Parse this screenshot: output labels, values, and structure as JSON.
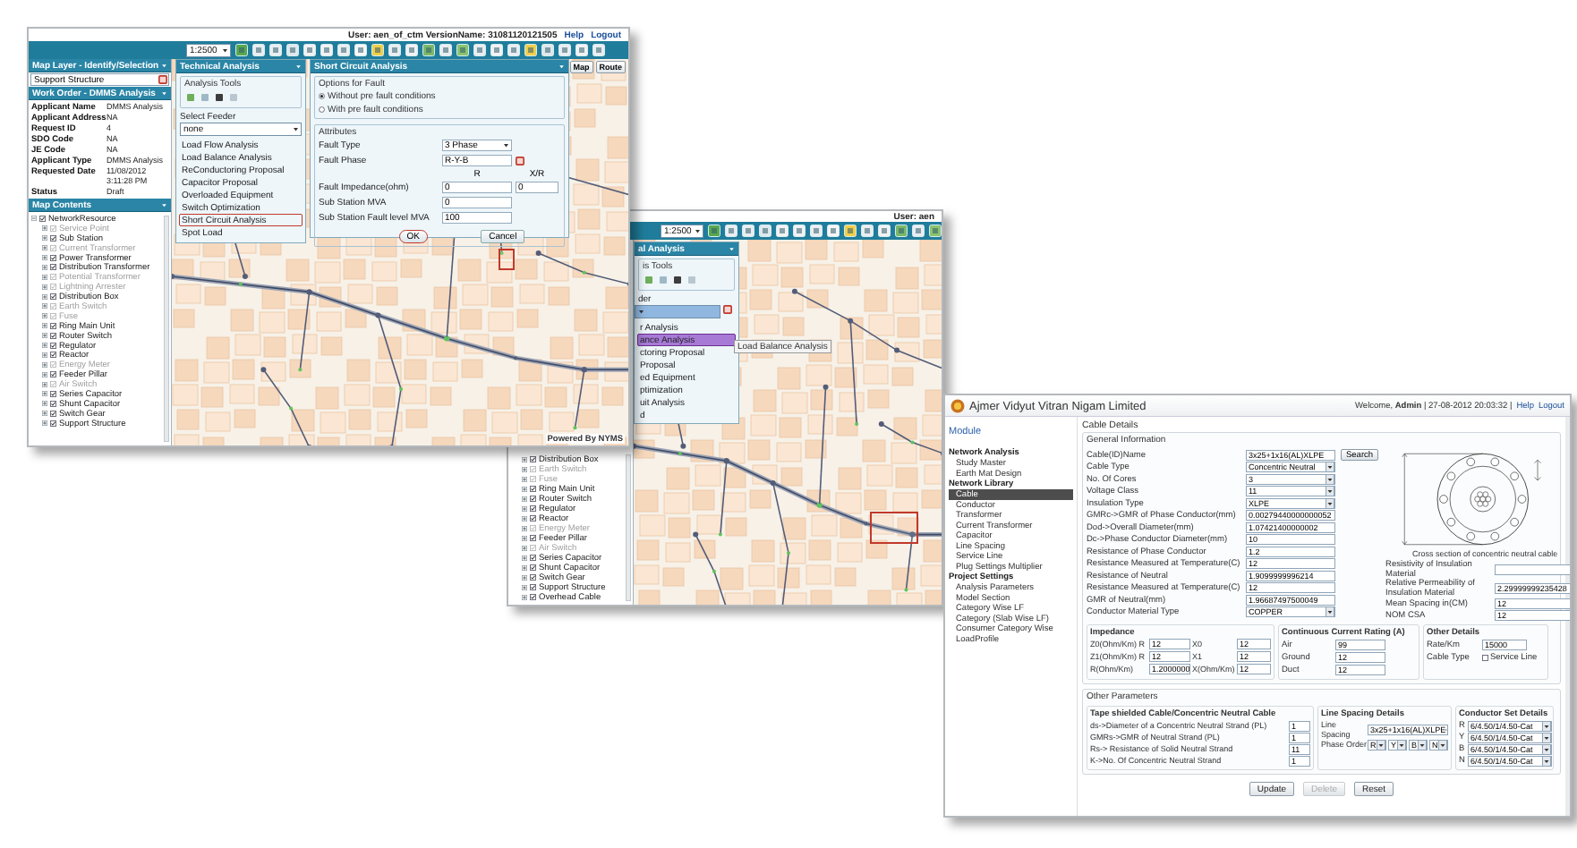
{
  "analysis_window": {
    "user_info": "User: aen",
    "scale": "1:2500",
    "tree_items": [
      {
        "label": "Distribution Box",
        "enabled": true
      },
      {
        "label": "Earth Switch",
        "enabled": false
      },
      {
        "label": "Fuse",
        "enabled": false
      },
      {
        "label": "Ring Main Unit",
        "enabled": true
      },
      {
        "label": "Router Switch",
        "enabled": true
      },
      {
        "label": "Regulator",
        "enabled": true
      },
      {
        "label": "Reactor",
        "enabled": true
      },
      {
        "label": "Energy Meter",
        "enabled": false
      },
      {
        "label": "Feeder Pillar",
        "enabled": true
      },
      {
        "label": "Air Switch",
        "enabled": false
      },
      {
        "label": "Series Capacitor",
        "enabled": true
      },
      {
        "label": "Shunt Capacitor",
        "enabled": true
      },
      {
        "label": "Switch Gear",
        "enabled": true
      },
      {
        "label": "Support Structure",
        "enabled": true
      },
      {
        "label": "Overhead Cable",
        "enabled": true
      }
    ],
    "technical_analysis": {
      "title": "al Analysis",
      "tools_label": "is Tools",
      "feeder_label": "der",
      "items": [
        {
          "label": "r Analysis",
          "selected": false
        },
        {
          "label": "ance Analysis",
          "selected": true
        },
        {
          "label": "ctoring Proposal",
          "selected": false
        },
        {
          "label": "Proposal",
          "selected": false
        },
        {
          "label": "ed Equipment",
          "selected": false
        },
        {
          "label": "ptimization",
          "selected": false
        },
        {
          "label": "uit Analysis",
          "selected": false
        },
        {
          "label": "d",
          "selected": false
        }
      ]
    },
    "tooltip": "Load Balance Analysis"
  },
  "map_window": {
    "user_info": "User: aen_of_ctm VersionName: 31081120121505",
    "links": [
      "Help",
      "Logout"
    ],
    "scale": "1:2500",
    "layer_panel": {
      "title": "Map Layer - Identify/Selection",
      "value": "Support Structure"
    },
    "work_order": {
      "title": "Work Order - DMMS Analysis",
      "rows": [
        {
          "label": "Applicant Name",
          "value": "DMMS Analysis"
        },
        {
          "label": "Applicant Address",
          "value": "NA"
        },
        {
          "label": "Request ID",
          "value": "4"
        },
        {
          "label": "SDO Code",
          "value": "NA"
        },
        {
          "label": "JE Code",
          "value": "NA"
        },
        {
          "label": "Applicant Type",
          "value": "DMMS Analysis"
        },
        {
          "label": "Requested Date",
          "value": "11/08/2012 3:11:28 PM"
        },
        {
          "label": "Status",
          "value": "Draft"
        }
      ]
    },
    "map_contents": {
      "title": "Map Contents",
      "root": "NetworkResource",
      "root_checked": true,
      "items": [
        {
          "label": "Service Point",
          "enabled": false
        },
        {
          "label": "Sub Station",
          "enabled": true
        },
        {
          "label": "Current Transformer",
          "enabled": false
        },
        {
          "label": "Power Transformer",
          "enabled": true
        },
        {
          "label": "Distribution Transformer",
          "enabled": true
        },
        {
          "label": "Potential Transformer",
          "enabled": false
        },
        {
          "label": "Lightning Arrester",
          "enabled": false
        },
        {
          "label": "Distribution Box",
          "enabled": true
        },
        {
          "label": "Earth Switch",
          "enabled": false
        },
        {
          "label": "Fuse",
          "enabled": false
        },
        {
          "label": "Ring Main Unit",
          "enabled": true
        },
        {
          "label": "Router Switch",
          "enabled": true
        },
        {
          "label": "Regulator",
          "enabled": true
        },
        {
          "label": "Reactor",
          "enabled": true
        },
        {
          "label": "Energy Meter",
          "enabled": false
        },
        {
          "label": "Feeder Pillar",
          "enabled": true
        },
        {
          "label": "Air Switch",
          "enabled": false
        },
        {
          "label": "Series Capacitor",
          "enabled": true
        },
        {
          "label": "Shunt Capacitor",
          "enabled": true
        },
        {
          "label": "Switch Gear",
          "enabled": true
        },
        {
          "label": "Support Structure",
          "enabled": true
        }
      ]
    },
    "technical_analysis": {
      "title": "Technical Analysis",
      "tools_label": "Analysis Tools",
      "feeder_label": "Select Feeder",
      "feeder": "none",
      "items": [
        {
          "label": "Load Flow Analysis",
          "selected": false
        },
        {
          "label": "Load Balance Analysis",
          "selected": false
        },
        {
          "label": "ReConductoring Proposal",
          "selected": false
        },
        {
          "label": "Capacitor Proposal",
          "selected": false
        },
        {
          "label": "Overloaded Equipment",
          "selected": false
        },
        {
          "label": "Switch Optimization",
          "selected": false
        },
        {
          "label": "Short Circuit Analysis",
          "selected": true
        },
        {
          "label": "Spot Load",
          "selected": false
        }
      ]
    },
    "short_circuit": {
      "title": "Short Circuit Analysis",
      "options_label": "Options for Fault",
      "options": [
        {
          "label": "Without pre fault conditions",
          "selected": true
        },
        {
          "label": "With pre fault conditions",
          "selected": false
        }
      ],
      "attributes_label": "Attributes",
      "fault_type_label": "Fault Type",
      "fault_type": "3 Phase",
      "fault_phase_label": "Fault Phase",
      "fault_phase": "R-Y-B",
      "columns": [
        "R",
        "X/R"
      ],
      "fault_impedance_label": "Fault Impedance(ohm)",
      "fault_impedance": [
        "0",
        "0"
      ],
      "mva_label": "Sub Station MVA",
      "mva": "0",
      "fault_level_label": "Sub Station Fault level MVA",
      "fault_level": "100",
      "buttons": [
        "OK",
        "Cancel"
      ]
    },
    "map_buttons": [
      "Map",
      "Route"
    ],
    "footer": "Powered By NYMS"
  },
  "cable_window": {
    "org": "Ajmer Vidyut Vitran Nigam Limited",
    "welcome": "Welcome, **Admin** | 27-08-2012 20:03:32 |",
    "links": [
      "Help",
      "Logout"
    ],
    "sidebar": {
      "title": "Module",
      "groups": [
        {
          "label": "Network Analysis",
          "items": [
            {
              "label": "Study Master",
              "selected": false
            },
            {
              "label": "Earth Mat Design",
              "selected": false
            }
          ]
        },
        {
          "label": "Network Library",
          "items": [
            {
              "label": "Cable",
              "selected": true
            },
            {
              "label": "Conductor",
              "selected": false
            },
            {
              "label": "Transformer",
              "selected": false
            },
            {
              "label": "Current Transformer",
              "selected": false
            },
            {
              "label": "Capacitor",
              "selected": false
            },
            {
              "label": "Line Spacing",
              "selected": false
            },
            {
              "label": "Service Line",
              "selected": false
            },
            {
              "label": "Plug Settings Multiplier",
              "selected": false
            }
          ]
        },
        {
          "label": "Project Settings",
          "items": [
            {
              "label": "Analysis Parameters",
              "selected": false
            },
            {
              "label": "Model Section",
              "selected": false
            },
            {
              "label": "Category Wise LF",
              "selected": false
            },
            {
              "label": "Category (Slab Wise LF)",
              "selected": false
            },
            {
              "label": "Consumer Category Wise LoadProfile",
              "selected": false
            }
          ]
        }
      ]
    },
    "title": "Cable Details",
    "general": {
      "title": "General Information",
      "fields": [
        {
          "label": "Cable(ID)Name",
          "value": "3x25+1x16(AL)XLPE",
          "kind": "search",
          "button": "Search"
        },
        {
          "label": "Cable Type",
          "value": "Concentric Neutral",
          "kind": "select"
        },
        {
          "label": "No. Of Cores",
          "value": "3",
          "kind": "select"
        },
        {
          "label": "Voltage Class",
          "value": "11",
          "kind": "select"
        },
        {
          "label": "Insulation Type",
          "value": "XLPE",
          "kind": "select"
        },
        {
          "label": "GMRc->GMR of Phase Conductor(mm)",
          "value": "0.00279440000000052",
          "kind": "text"
        },
        {
          "label": "Dod->Overall Diameter(mm)",
          "value": "1.07421400000002",
          "kind": "text"
        },
        {
          "label": "Dc->Phase Conductor Diameter(mm)",
          "value": "10",
          "kind": "text"
        },
        {
          "label": "Resistance of Phase Conductor",
          "value": "1.2",
          "kind": "text"
        },
        {
          "label": "Resistance Measured at Temperature(C)",
          "value": "12",
          "kind": "text"
        },
        {
          "label": "Resistance of Neutral",
          "value": "1.9099999996214",
          "kind": "text"
        },
        {
          "label": "Resistance Measured at Temperature(C)",
          "value": "12",
          "kind": "text"
        },
        {
          "label": "GMR of Neutral(mm)",
          "value": "1.96687497500049",
          "kind": "text"
        },
        {
          "label": "Conductor Material Type",
          "value": "COPPER",
          "kind": "select"
        }
      ]
    },
    "diagram_caption": "Cross section of concentric neutral cable",
    "extra_fields": [
      {
        "label": "Resistivity of Insulation Material"
      },
      {
        "label": "Relative Permeability of Insulation Material",
        "value": "2.29999999235428"
      },
      {
        "label": "Mean Spacing in(CM)",
        "value": "12"
      },
      {
        "label": "NOM CSA",
        "value": "12"
      }
    ],
    "impedance": {
      "title": "Impedance",
      "cells": [
        {
          "label": "Z0(Ohm/Km) R",
          "value": "12"
        },
        {
          "label": "X0",
          "value": "12"
        },
        {
          "label": "Z1(Ohm/Km) R",
          "value": "12"
        },
        {
          "label": "X1",
          "value": "12"
        },
        {
          "label": "R(Ohm/Km)",
          "value": "1.2000000"
        },
        {
          "label": "X(Ohm/Km)",
          "value": "12"
        }
      ]
    },
    "current_rating": {
      "title": "Continuous Current Rating (A)",
      "fields": [
        {
          "label": "Air",
          "value": "99"
        },
        {
          "label": "Ground",
          "value": "12"
        },
        {
          "label": "Duct",
          "value": "12"
        }
      ]
    },
    "other_details": {
      "title": "Other Details",
      "rate_label": "Rate/Km",
      "rate": "15000",
      "cable_type_label": "Cable Type",
      "service_line": {
        "label": "Service Line",
        "checked": false
      }
    },
    "other_parameters": {
      "title": "Other Parameters",
      "tape": {
        "title": "Tape shielded Cable/Concentric Neutral Cable",
        "fields": [
          {
            "label": "ds->Diameter of a Concentric Neutral Strand (PL)",
            "value": "1"
          },
          {
            "label": "GMRs->GMR of Neutral Strand (PL)",
            "value": "1"
          },
          {
            "label": "Rs-> Resistance of Solid Neutral Strand",
            "value": "11"
          },
          {
            "label": "K->No. Of Concentric Neutral Strand",
            "value": "1"
          }
        ]
      },
      "line_spacing": {
        "title": "Line Spacing Details",
        "spacing_label": "Line Spacing",
        "spacing": "3x25+1x16(AL)XLPE",
        "phase_label": "Phase Order",
        "phases": [
          "R",
          "Y",
          "B",
          "N"
        ]
      },
      "conductor_set": {
        "title": "Conductor Set Details",
        "rows": [
          {
            "phase": "R",
            "value": "6/4.50/1/4.50-Cat"
          },
          {
            "phase": "Y",
            "value": "6/4.50/1/4.50-Cat"
          },
          {
            "phase": "B",
            "value": "6/4.50/1/4.50-Cat"
          },
          {
            "phase": "N",
            "value": "6/4.50/1/4.50-Cat"
          }
        ]
      }
    },
    "buttons": [
      {
        "label": "Update",
        "disabled": false
      },
      {
        "label": "Delete",
        "disabled": true
      },
      {
        "label": "Reset",
        "disabled": false
      }
    ]
  }
}
